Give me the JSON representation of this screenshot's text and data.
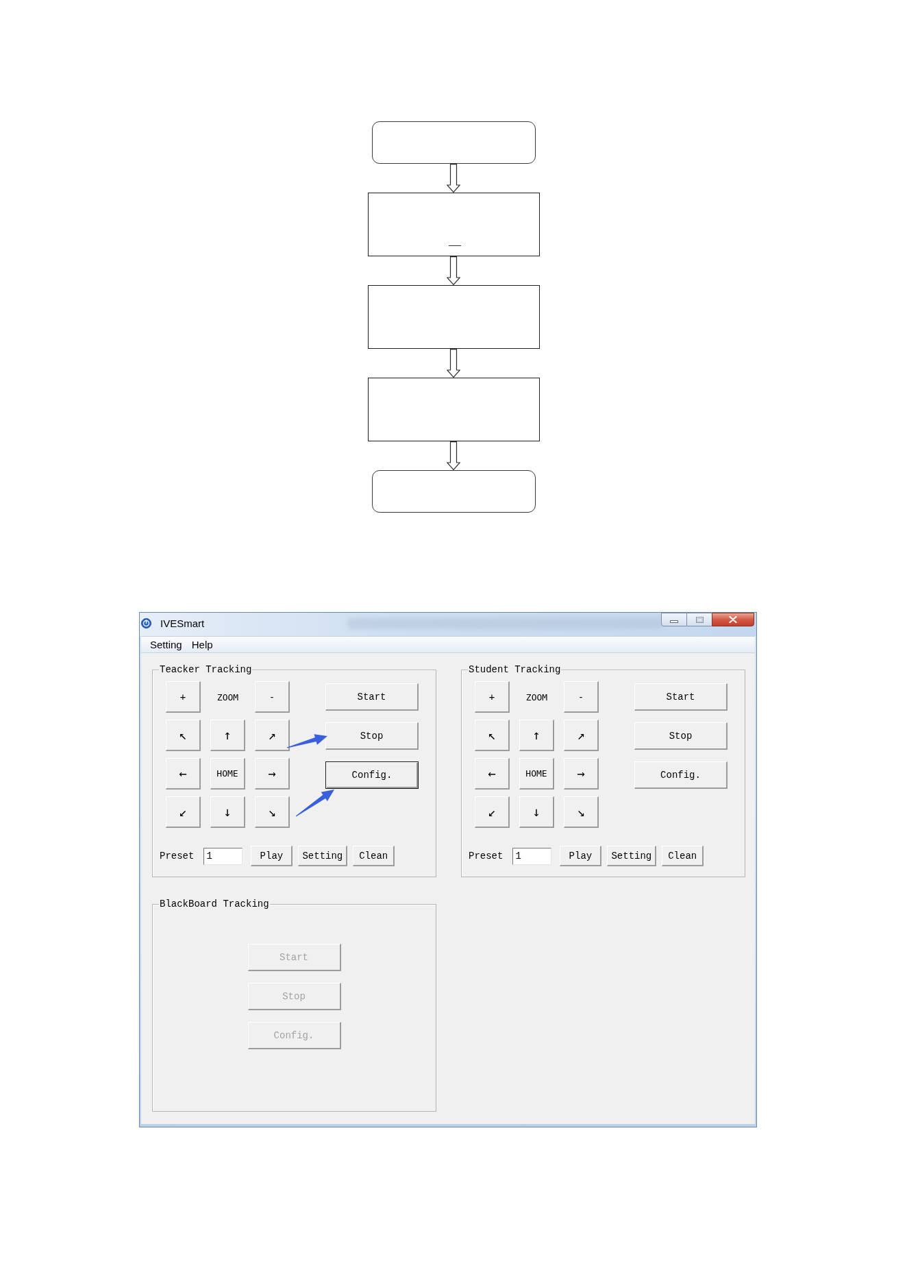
{
  "flowchart": {
    "steps": [
      {
        "kind": "terminal"
      },
      {
        "kind": "marked"
      },
      {
        "kind": "process"
      },
      {
        "kind": "process"
      },
      {
        "kind": "terminal"
      }
    ]
  },
  "window": {
    "title": "IVESmart",
    "menu": [
      "Setting",
      "Help"
    ]
  },
  "groups": [
    {
      "title": "Teacker Tracking",
      "kind": "camera",
      "pad": [
        {
          "kind": "button",
          "label": "+"
        },
        {
          "kind": "label",
          "label": "ZOOM"
        },
        {
          "kind": "button",
          "label": "-"
        },
        {
          "kind": "button",
          "label": "↖"
        },
        {
          "kind": "button",
          "label": "↑"
        },
        {
          "kind": "button",
          "label": "↗"
        },
        {
          "kind": "button",
          "label": "←"
        },
        {
          "kind": "button",
          "label": "HOME"
        },
        {
          "kind": "button",
          "label": "→"
        },
        {
          "kind": "button",
          "label": "↙"
        },
        {
          "kind": "button",
          "label": "↓"
        },
        {
          "kind": "button",
          "label": "↘"
        }
      ],
      "actions": [
        {
          "label": "Start",
          "disabled": false,
          "focused": false,
          "arrow": false
        },
        {
          "label": "Stop",
          "disabled": false,
          "focused": false,
          "arrow": true
        },
        {
          "label": "Config.",
          "disabled": false,
          "focused": true,
          "arrow": true
        }
      ],
      "preset": {
        "label": "Preset",
        "value": "1"
      },
      "preset_buttons": [
        "Play",
        "Setting",
        "Clean"
      ]
    },
    {
      "title": "Student Tracking",
      "kind": "camera",
      "pad": [
        {
          "kind": "button",
          "label": "+"
        },
        {
          "kind": "label",
          "label": "ZOOM"
        },
        {
          "kind": "button",
          "label": "-"
        },
        {
          "kind": "button",
          "label": "↖"
        },
        {
          "kind": "button",
          "label": "↑"
        },
        {
          "kind": "button",
          "label": "↗"
        },
        {
          "kind": "button",
          "label": "←"
        },
        {
          "kind": "button",
          "label": "HOME"
        },
        {
          "kind": "button",
          "label": "→"
        },
        {
          "kind": "button",
          "label": "↙"
        },
        {
          "kind": "button",
          "label": "↓"
        },
        {
          "kind": "button",
          "label": "↘"
        }
      ],
      "actions": [
        {
          "label": "Start",
          "disabled": false,
          "focused": false,
          "arrow": false
        },
        {
          "label": "Stop",
          "disabled": false,
          "focused": false,
          "arrow": false
        },
        {
          "label": "Config.",
          "disabled": false,
          "focused": false,
          "arrow": false
        }
      ],
      "preset": {
        "label": "Preset",
        "value": "1"
      },
      "preset_buttons": [
        "Play",
        "Setting",
        "Clean"
      ]
    },
    {
      "title": "BlackBoard Tracking",
      "kind": "simple",
      "actions": [
        {
          "label": "Start",
          "disabled": true,
          "focused": false,
          "arrow": false
        },
        {
          "label": "Stop",
          "disabled": true,
          "focused": false,
          "arrow": false
        },
        {
          "label": "Config.",
          "disabled": true,
          "focused": false,
          "arrow": false
        }
      ]
    }
  ]
}
